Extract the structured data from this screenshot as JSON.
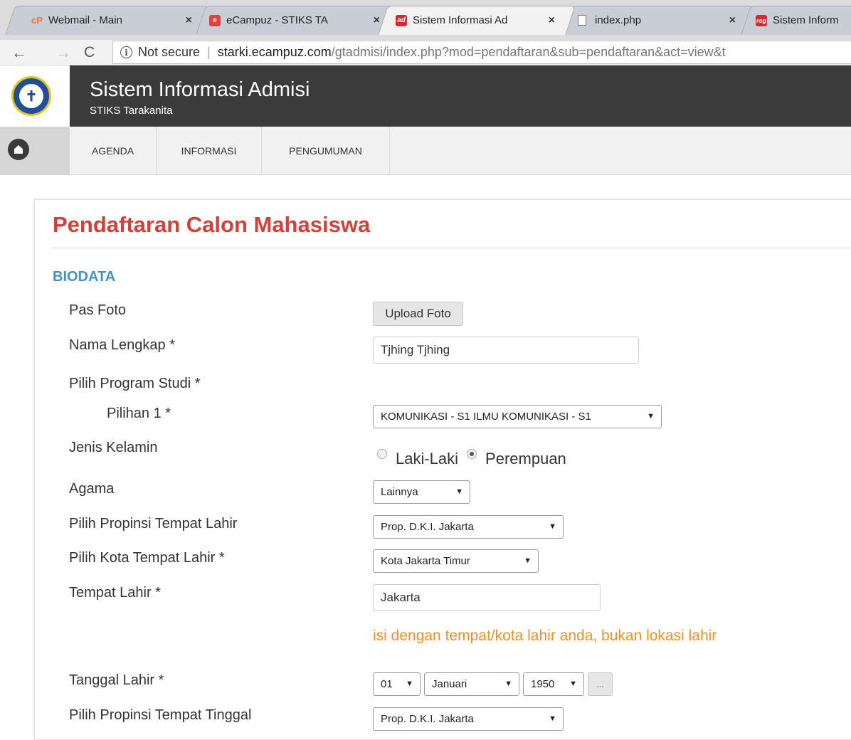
{
  "browser": {
    "tabs": [
      {
        "title": "Webmail - Main",
        "favicon": "cP",
        "favicon_color": "#ff6c2c"
      },
      {
        "title": "eCampuz - STIKS TA",
        "favicon": "e",
        "favicon_color": "#e04040"
      },
      {
        "title": "Sistem Informasi Ad",
        "favicon": "ad",
        "favicon_color": "#d9262f"
      },
      {
        "title": "index.php",
        "favicon": "page-icon",
        "favicon_color": "#ffffff"
      },
      {
        "title": "Sistem Inform",
        "favicon": "reg",
        "favicon_color": "#d9262f"
      }
    ],
    "close_glyph": "×",
    "security_label": "Not secure",
    "url_host": "starki.ecampuz.com",
    "url_path": "/gtadmisi/index.php?mod=pendaftaran&sub=pendaftaran&act=view&t"
  },
  "site": {
    "title": "Sistem Informasi Admisi",
    "subtitle": "STIKS Tarakanita",
    "nav": [
      "AGENDA",
      "INFORMASI",
      "PENGUMUMAN"
    ]
  },
  "form": {
    "page_title": "Pendaftaran Calon Mahasiswa",
    "section": "BIODATA",
    "labels": {
      "pas_foto": "Pas Foto",
      "nama": "Nama Lengkap *",
      "prodi": "Pilih Program Studi *",
      "pilihan1": "Pilihan 1 *",
      "jenis_kelamin": "Jenis Kelamin",
      "agama": "Agama",
      "propinsi_lahir": "Pilih Propinsi Tempat Lahir",
      "kota_lahir": "Pilih Kota Tempat Lahir *",
      "tempat_lahir": "Tempat Lahir *",
      "tanggal_lahir": "Tanggal Lahir *",
      "propinsi_tinggal": "Pilih Propinsi Tempat Tinggal"
    },
    "upload_label": "Upload Foto",
    "nama_value": "Tjhing Tjhing",
    "pilihan1_value": "KOMUNIKASI - S1 ILMU KOMUNIKASI - S1",
    "gender_options": [
      "Laki-Laki",
      "Perempuan"
    ],
    "gender_selected": "Perempuan",
    "agama_value": "Lainnya",
    "propinsi_lahir_value": "Prop. D.K.I. Jakarta",
    "kota_lahir_value": "Kota Jakarta Timur",
    "tempat_lahir_value": "Jakarta",
    "tempat_hint": "isi dengan tempat/kota lahir anda, bukan lokasi lahir",
    "tgl_day": "01",
    "tgl_month": "Januari",
    "tgl_year": "1950",
    "date_picker_label": "...",
    "propinsi_tinggal_value": "Prop. D.K.I. Jakarta",
    "caret": "▼"
  },
  "colors": {
    "title_red": "#d43f3a",
    "section_blue": "#4a8fc4",
    "hint_orange": "#f0901e",
    "header_dark": "#3b3b3b"
  }
}
